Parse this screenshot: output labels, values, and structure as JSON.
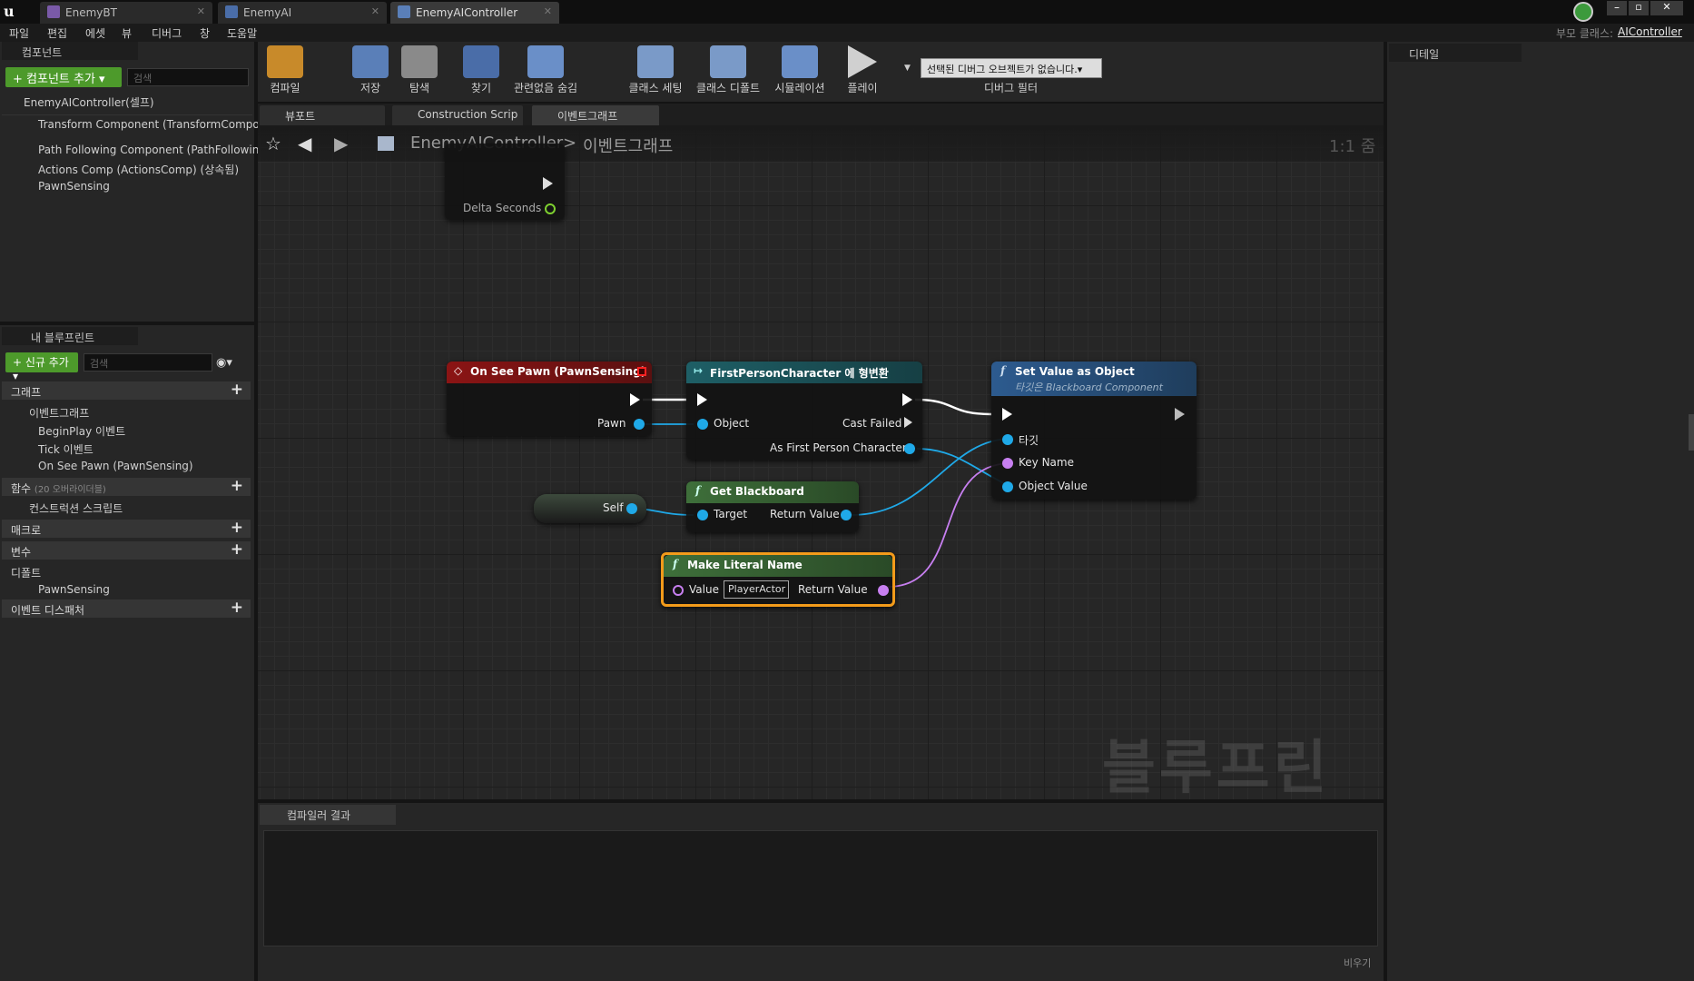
{
  "tabs": [
    {
      "label": "EnemyBT"
    },
    {
      "label": "EnemyAI"
    },
    {
      "label": "EnemyAIController"
    }
  ],
  "menu": [
    "파일",
    "편집",
    "에셋",
    "뷰",
    "디버그",
    "창",
    "도움말"
  ],
  "parent_class": {
    "label": "부모 클래스:",
    "value": "AIController"
  },
  "components": {
    "title": "컴포넌트",
    "add_button": "+ 컴포넌트 추가 ▾",
    "search_placeholder": "검색",
    "root": "EnemyAIController(셀프)",
    "items": [
      "Transform Component (TransformCompon",
      "Path Following Component (PathFollowing",
      "Actions Comp (ActionsComp) (상속됨)",
      "PawnSensing"
    ]
  },
  "mybp": {
    "title": "내 블루프린트",
    "add_button": "+ 신규 추가 ▾",
    "search_placeholder": "검색",
    "graphs": "그래프",
    "eventgraph": "이벤트그래프",
    "events": [
      "BeginPlay 이벤트",
      "Tick 이벤트",
      "On See Pawn (PawnSensing)"
    ],
    "functions": "함수",
    "functions_note": "(20 오버라이더블)",
    "construction": "컨스트럭션 스크립트",
    "macros": "매크로",
    "variables": "변수",
    "components_cat": "디폴트",
    "var_items": [
      "PawnSensing"
    ],
    "dispatchers": "이벤트 디스패처"
  },
  "toolbar": {
    "buttons": [
      "컴파일",
      "저장",
      "탐색",
      "찾기",
      "관련없음 숨김",
      "클래스 세팅",
      "클래스 디폴트",
      "시뮬레이션",
      "플레이"
    ],
    "debug_select": "선택된 디버그 오브젝트가 없습니다.▾",
    "debug_filter": "디버그 필터"
  },
  "graph_tabs": [
    "뷰포트",
    "Construction Scrip",
    "이벤트그래프"
  ],
  "breadcrumb": {
    "root": "EnemyAIController",
    "sep": ">",
    "current": "이벤트그래프",
    "zoom": "1:1 줌"
  },
  "watermark": "블루프린트",
  "nodes": {
    "tick_partial": {
      "pin": "Delta Seconds"
    },
    "on_see": {
      "title": "On See Pawn (PawnSensing)",
      "pin_pawn": "Pawn"
    },
    "cast": {
      "title": "FirstPersonCharacter 에 형변환",
      "pin_object": "Object",
      "pin_failed": "Cast Failed",
      "pin_as": "As First Person Character"
    },
    "setvalue": {
      "title": "Set Value as Object",
      "subtitle": "타깃은 Blackboard Component",
      "pin_target": "타깃",
      "pin_key": "Key Name",
      "pin_value": "Object Value"
    },
    "self": {
      "label": "Self"
    },
    "getbb": {
      "title": "Get Blackboard",
      "pin_target": "Target",
      "pin_return": "Return Value"
    },
    "literal": {
      "title": "Make Literal Name",
      "pin_value": "Value",
      "value": "PlayerActor",
      "pin_return": "Return Value"
    }
  },
  "compiler": {
    "title": "컴파일러 결과",
    "clear": "비우기"
  },
  "details": {
    "title": "디테일"
  },
  "colors": {
    "exec": "#ffffff",
    "object": "#1fa9e8",
    "name": "#c77ff0",
    "event_head": "#8b1414",
    "cast_head": "#1e5f66",
    "func_head": "#2d5b8f",
    "pure_head": "#3e6f3a",
    "select": "#f39b1a"
  }
}
